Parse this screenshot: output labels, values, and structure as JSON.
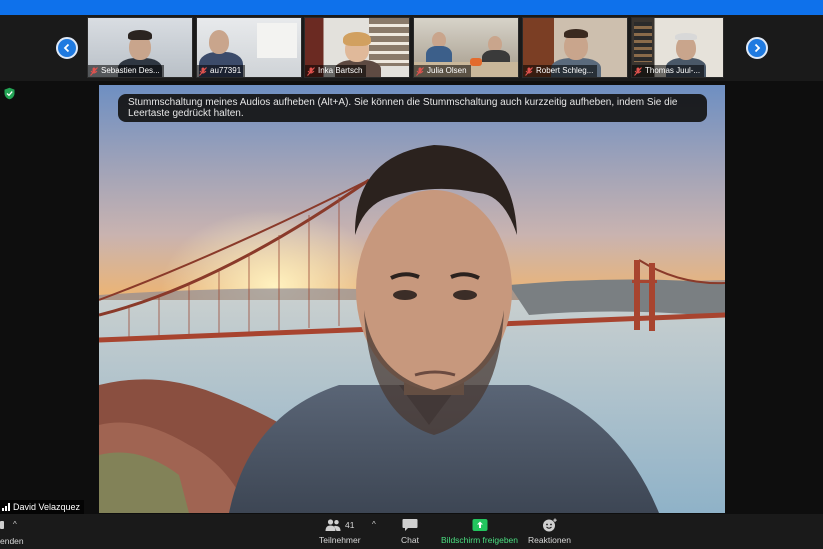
{
  "participants": [
    {
      "name": "Sebastien Des..."
    },
    {
      "name": "au77391"
    },
    {
      "name": "Inka Bartsch"
    },
    {
      "name": "Julia Olsen"
    },
    {
      "name": "Robert Schleg..."
    },
    {
      "name": "Thomas Juul-..."
    }
  ],
  "tooltip": {
    "text": "Stummschaltung meines Audios aufheben (Alt+A). Sie können die Stummschaltung auch kurzzeitig aufheben, indem Sie die Leertaste gedrückt halten."
  },
  "speaker": {
    "name": "David Velazquez"
  },
  "toolbar": {
    "end_label": "enden",
    "participants_label": "Teilnehmer",
    "participants_count": "41",
    "chat_label": "Chat",
    "share_label": "Bildschirm freigeben",
    "reactions_label": "Reaktionen"
  },
  "colors": {
    "accent": "#0e71eb",
    "share_green": "#22c55e",
    "muted_red": "#e0524e"
  }
}
